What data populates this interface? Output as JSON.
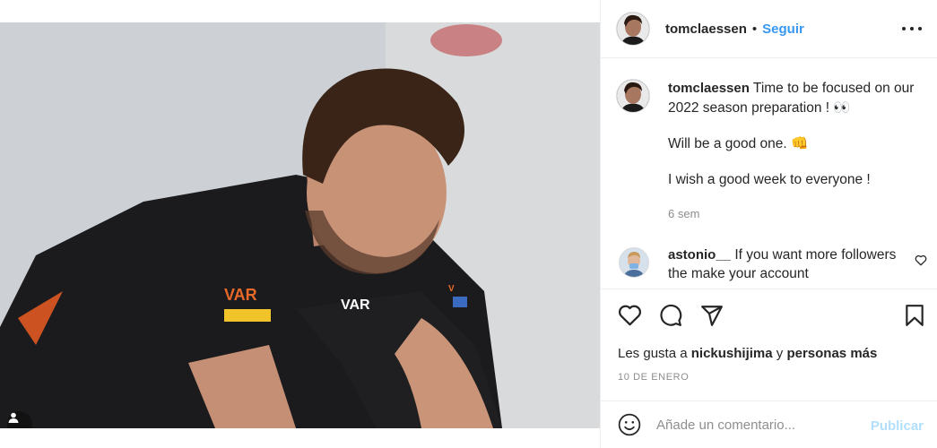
{
  "post": {
    "image_alt": "Man in black VAR team shirt leaning forward"
  },
  "header": {
    "username": "tomclaessen",
    "separator": "•",
    "follow_label": "Seguir",
    "more_icon": "more-horizontal-icon"
  },
  "caption": {
    "username": "tomclaessen",
    "line1": "Time to be focused on our 2022 season preparation ! 👀",
    "line2": "Will be a good one. 👊",
    "line3": "I wish a good week to everyone !",
    "time": "6 sem"
  },
  "comment": {
    "username": "astonio__",
    "text": "If you want more followers the make your account"
  },
  "actions": {
    "like_icon": "heart-icon",
    "comment_icon": "comment-icon",
    "share_icon": "send-icon",
    "save_icon": "bookmark-icon"
  },
  "likes": {
    "prefix": "Les gusta a",
    "user": "nickushijima",
    "middle": "y",
    "others": "personas más"
  },
  "date": "10 DE ENERO",
  "add_comment": {
    "emoji_icon": "emoji-icon",
    "placeholder": "Añade un comentario...",
    "publish_label": "Publicar"
  },
  "colors": {
    "link": "#3897f0",
    "publish_disabled": "#b2dffc",
    "muted": "#8e8e8e",
    "text": "#262626"
  }
}
